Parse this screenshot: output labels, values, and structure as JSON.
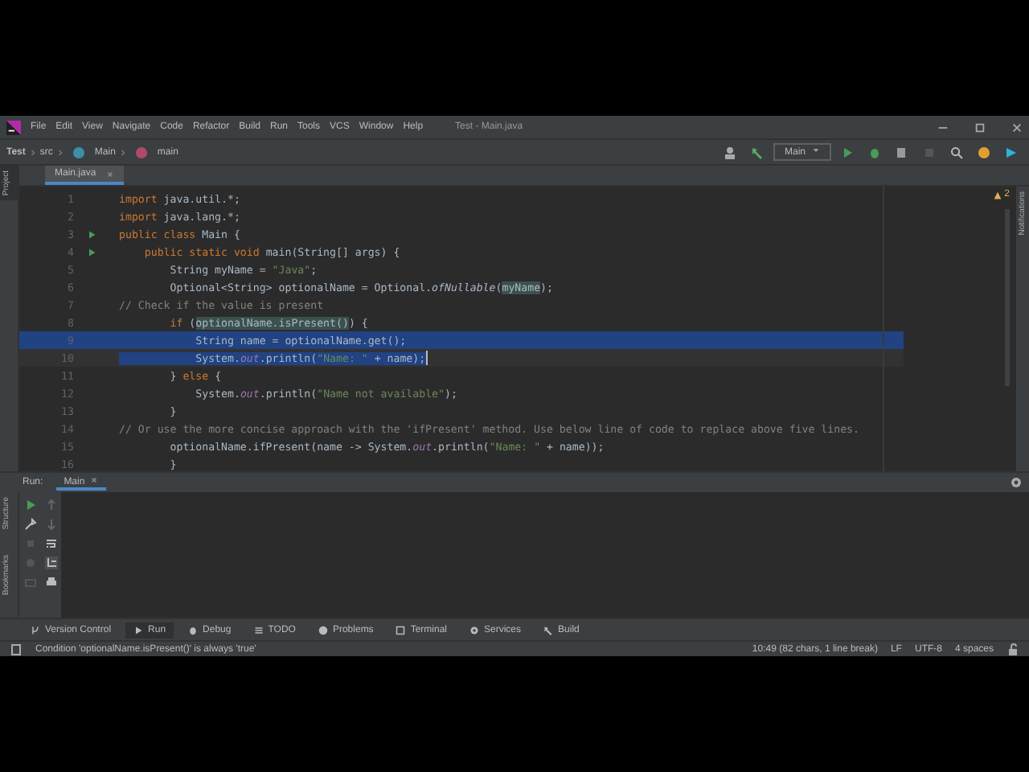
{
  "window": {
    "title": "Test - Main.java"
  },
  "menu": [
    "File",
    "Edit",
    "View",
    "Navigate",
    "Code",
    "Refactor",
    "Build",
    "Run",
    "Tools",
    "VCS",
    "Window",
    "Help"
  ],
  "breadcrumbs": [
    "Test",
    "src",
    "Main",
    "main"
  ],
  "run_config": "Main",
  "side_tabs": {
    "left_top": "Project",
    "left_bottom": [
      "Structure",
      "Bookmarks"
    ],
    "right": "Notifications"
  },
  "editor_tabs": [
    {
      "label": "Main.java",
      "selected": true
    }
  ],
  "warnings": "2",
  "lines": [
    {
      "number": "1",
      "run": false,
      "caret": false,
      "selected": false,
      "tokens": [
        {
          "kind": "kw",
          "t": "import"
        },
        {
          "kind": "p",
          "t": " java.util.*;"
        }
      ]
    },
    {
      "number": "2",
      "run": false,
      "caret": false,
      "selected": false,
      "tokens": [
        {
          "kind": "kw",
          "t": "import"
        },
        {
          "kind": "p",
          "t": " java.lang.*;"
        }
      ]
    },
    {
      "number": "3",
      "run": true,
      "caret": false,
      "selected": false,
      "tokens": [
        {
          "kind": "kw",
          "t": "public class"
        },
        {
          "kind": "p",
          "t": " Main {"
        }
      ]
    },
    {
      "number": "4",
      "run": true,
      "caret": false,
      "selected": false,
      "tokens": [
        {
          "kind": "kw",
          "t": "    public static void"
        },
        {
          "kind": "p",
          "t": " main(String[] args) {"
        }
      ]
    },
    {
      "number": "5",
      "run": false,
      "caret": false,
      "selected": false,
      "tokens": [
        {
          "kind": "p",
          "t": "        String myName = "
        },
        {
          "kind": "str",
          "t": "\"Java\""
        },
        {
          "kind": "p",
          "t": ";"
        }
      ]
    },
    {
      "number": "6",
      "run": false,
      "caret": false,
      "selected": false,
      "tokens": [
        {
          "kind": "p",
          "t": "        Optional<String> optionalName = Optional."
        },
        {
          "kind": "it",
          "t": "ofNullable"
        },
        {
          "kind": "p",
          "t": "("
        },
        {
          "kind": "hl",
          "t": "myName"
        },
        {
          "kind": "p",
          "t": ");"
        }
      ]
    },
    {
      "number": "7",
      "run": false,
      "caret": false,
      "selected": false,
      "tokens": [
        {
          "kind": "cm",
          "t": "// Check if the value is present"
        }
      ]
    },
    {
      "number": "8",
      "run": false,
      "caret": false,
      "selected": false,
      "tokens": [
        {
          "kind": "kw",
          "t": "        if"
        },
        {
          "kind": "p",
          "t": " ("
        },
        {
          "kind": "hl",
          "t": "optionalName.isPresent()"
        },
        {
          "kind": "p",
          "t": ") {"
        }
      ]
    },
    {
      "number": "9",
      "run": false,
      "caret": false,
      "selected": true,
      "tokens": [
        {
          "kind": "p",
          "t": "            String name = optionalName.get();"
        }
      ]
    },
    {
      "number": "10",
      "run": false,
      "caret": true,
      "selected": true,
      "tokens": [
        {
          "kind": "p",
          "t": "            System."
        },
        {
          "kind": "fld",
          "t": "out"
        },
        {
          "kind": "p",
          "t": ".println("
        },
        {
          "kind": "str",
          "t": "\"Name: \""
        },
        {
          "kind": "p",
          "t": " + name);"
        }
      ]
    },
    {
      "number": "11",
      "run": false,
      "caret": false,
      "selected": false,
      "tokens": [
        {
          "kind": "p",
          "t": "        } "
        },
        {
          "kind": "kw",
          "t": "else"
        },
        {
          "kind": "p",
          "t": " {"
        }
      ]
    },
    {
      "number": "12",
      "run": false,
      "caret": false,
      "selected": false,
      "tokens": [
        {
          "kind": "p",
          "t": "            System."
        },
        {
          "kind": "fld",
          "t": "out"
        },
        {
          "kind": "p",
          "t": ".println("
        },
        {
          "kind": "str",
          "t": "\"Name not available\""
        },
        {
          "kind": "p",
          "t": ");"
        }
      ]
    },
    {
      "number": "13",
      "run": false,
      "caret": false,
      "selected": false,
      "tokens": [
        {
          "kind": "p",
          "t": "        }"
        }
      ]
    },
    {
      "number": "14",
      "run": false,
      "caret": false,
      "selected": false,
      "tokens": [
        {
          "kind": "cm",
          "t": "// Or use the more concise approach with the 'ifPresent' method. Use below line of code to replace above five lines."
        }
      ]
    },
    {
      "number": "15",
      "run": false,
      "caret": false,
      "selected": false,
      "tokens": [
        {
          "kind": "p",
          "t": "        optionalName.ifPresent(name -> System."
        },
        {
          "kind": "fld",
          "t": "out"
        },
        {
          "kind": "p",
          "t": ".println("
        },
        {
          "kind": "str",
          "t": "\"Name: \""
        },
        {
          "kind": "p",
          "t": " + name));"
        }
      ]
    },
    {
      "number": "16",
      "run": false,
      "caret": false,
      "selected": false,
      "tokens": [
        {
          "kind": "p",
          "t": "        }"
        }
      ]
    }
  ],
  "run_panel": {
    "label": "Run:",
    "tabs": [
      {
        "label": "Main",
        "selected": true
      }
    ]
  },
  "tool_windows": [
    {
      "label": "Version Control",
      "kind": "vcs",
      "selected": false
    },
    {
      "label": "Run",
      "kind": "run",
      "selected": true
    },
    {
      "label": "Debug",
      "kind": "debug",
      "selected": false
    },
    {
      "label": "TODO",
      "kind": "todo",
      "selected": false
    },
    {
      "label": "Problems",
      "kind": "problems",
      "selected": false
    },
    {
      "label": "Terminal",
      "kind": "terminal",
      "selected": false
    },
    {
      "label": "Services",
      "kind": "services",
      "selected": false
    },
    {
      "label": "Build",
      "kind": "build",
      "selected": false
    }
  ],
  "status_bar": {
    "message": "Condition 'optionalName.isPresent()' is always 'true'",
    "position": "10:49 (82 chars, 1 line break)",
    "line_ending": "LF",
    "encoding": "UTF-8",
    "indent": "4 spaces"
  }
}
